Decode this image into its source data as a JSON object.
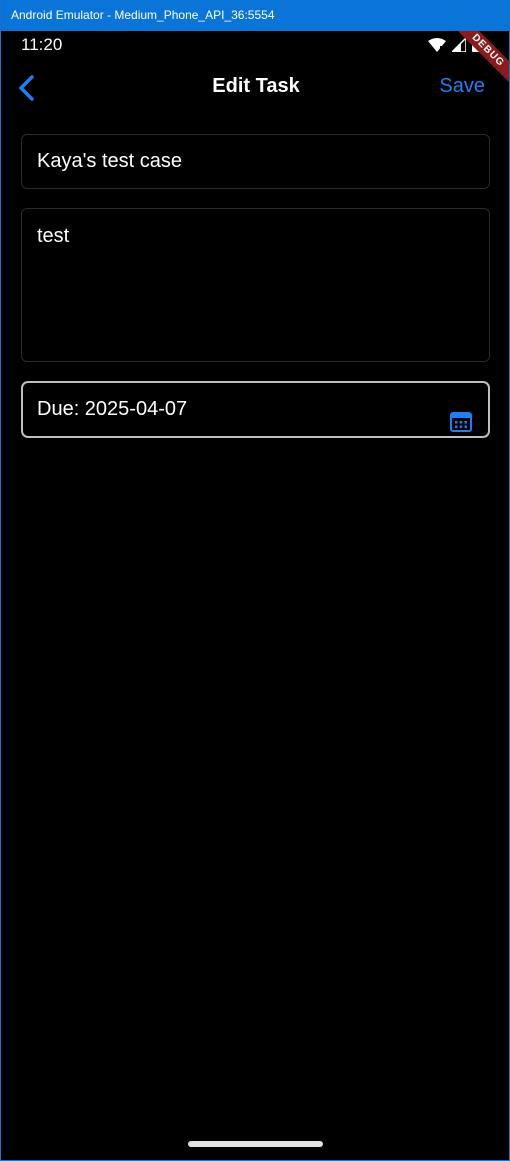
{
  "window": {
    "title": "Android Emulator - Medium_Phone_API_36:5554"
  },
  "status_bar": {
    "time": "11:20",
    "icons": [
      "wifi-icon",
      "signal-icon",
      "battery-icon"
    ]
  },
  "debug_banner": {
    "label": "DEBUG",
    "color": "#8b1c1c"
  },
  "app_bar": {
    "back_icon": "chevron-left-icon",
    "title": "Edit Task",
    "save_label": "Save",
    "accent_color": "#1e7ef5"
  },
  "form": {
    "title_value": "Kaya's test case",
    "description_value": "test",
    "due_label": "Due: 2025-04-07",
    "calendar_icon": "calendar-icon"
  }
}
